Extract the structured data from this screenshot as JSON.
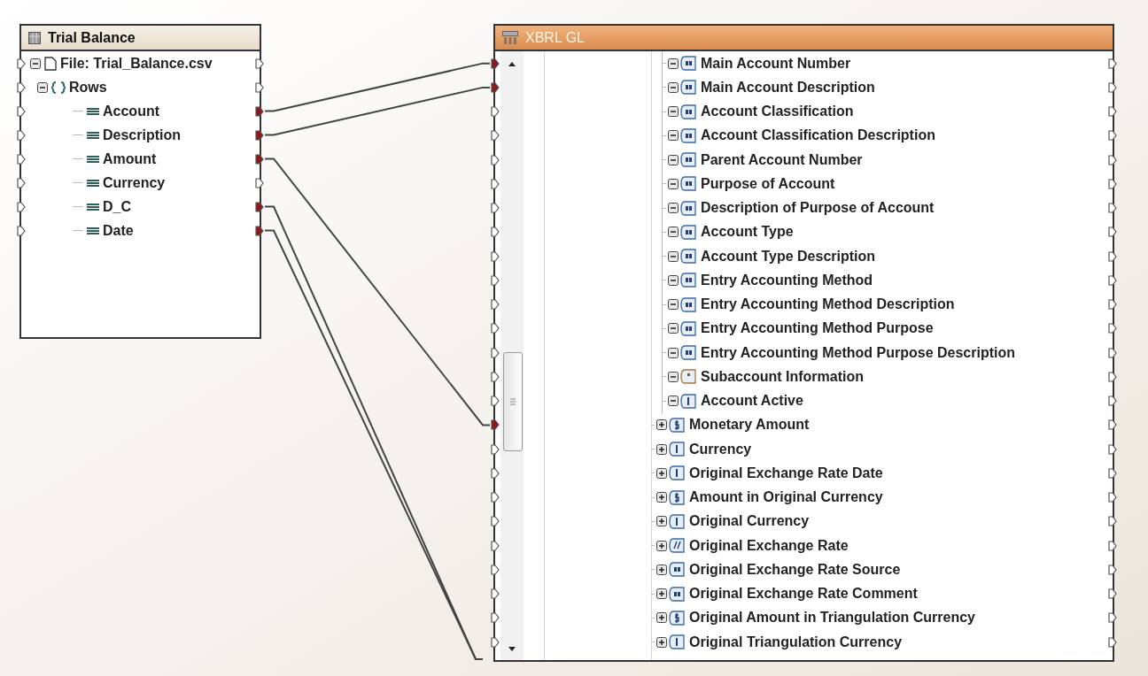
{
  "source": {
    "title": "Trial Balance",
    "file": {
      "label": "File: Trial_Balance.csv",
      "expanded": true,
      "connected": false,
      "children": [
        {
          "label": "Rows",
          "expanded": true,
          "connected": false,
          "children": [
            {
              "label": "Account",
              "connected": true
            },
            {
              "label": "Description",
              "connected": true
            },
            {
              "label": "Amount",
              "connected": true
            },
            {
              "label": "Currency",
              "connected": false
            },
            {
              "label": "D_C",
              "connected": true
            },
            {
              "label": "Date",
              "connected": true
            }
          ]
        }
      ]
    }
  },
  "target": {
    "title": "XBRL GL",
    "nested_items": [
      {
        "label": "Main Account Number",
        "kind": "text",
        "connected": true
      },
      {
        "label": "Main Account Description",
        "kind": "text",
        "connected": true
      },
      {
        "label": "Account Classification",
        "kind": "text",
        "connected": false
      },
      {
        "label": "Account Classification Description",
        "kind": "text",
        "connected": false
      },
      {
        "label": "Parent Account Number",
        "kind": "text",
        "connected": false
      },
      {
        "label": "Purpose of Account",
        "kind": "text",
        "connected": false
      },
      {
        "label": "Description of Purpose of Account",
        "kind": "text",
        "connected": false
      },
      {
        "label": "Account Type",
        "kind": "text",
        "connected": false
      },
      {
        "label": "Account Type Description",
        "kind": "text",
        "connected": false
      },
      {
        "label": "Entry Accounting Method",
        "kind": "text",
        "connected": false
      },
      {
        "label": "Entry Accounting Method Description",
        "kind": "text",
        "connected": false
      },
      {
        "label": "Entry Accounting Method Purpose",
        "kind": "text",
        "connected": false
      },
      {
        "label": "Entry Accounting Method Purpose Description",
        "kind": "text",
        "connected": false
      },
      {
        "label": "Subaccount Information",
        "kind": "group",
        "connected": false
      },
      {
        "label": "Account Active",
        "kind": "simple",
        "connected": false
      }
    ],
    "items": [
      {
        "label": "Monetary Amount",
        "kind": "money",
        "connected": true
      },
      {
        "label": "Currency",
        "kind": "simple",
        "connected": false
      },
      {
        "label": "Original Exchange Rate Date",
        "kind": "simple",
        "connected": false
      },
      {
        "label": "Amount in Original Currency",
        "kind": "money",
        "connected": false
      },
      {
        "label": "Original Currency",
        "kind": "simple",
        "connected": false
      },
      {
        "label": "Original Exchange Rate",
        "kind": "decimal",
        "connected": false
      },
      {
        "label": "Original Exchange Rate Source",
        "kind": "text",
        "connected": false
      },
      {
        "label": "Original Exchange Rate Comment",
        "kind": "text",
        "connected": false
      },
      {
        "label": "Original Amount in Triangulation Currency",
        "kind": "money",
        "connected": false
      },
      {
        "label": "Original Triangulation Currency",
        "kind": "simple",
        "connected": false
      }
    ]
  }
}
